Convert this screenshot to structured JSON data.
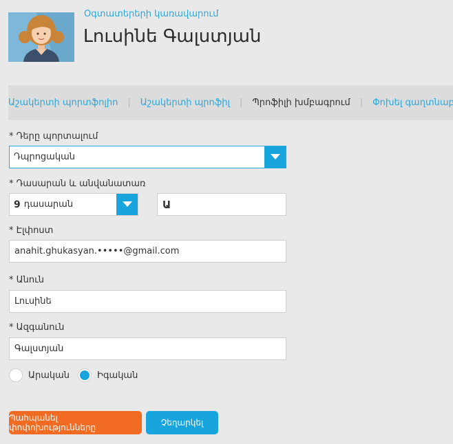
{
  "header": {
    "users_link": "Օգտատերերի կառավարում",
    "user_name": "Լուսինե Գալստյան"
  },
  "nav": {
    "items": [
      {
        "label": "Աշակերտի պորտֆոլիո",
        "active": false
      },
      {
        "label": "Աշակերտի պրոֆիլ",
        "active": false
      },
      {
        "label": "Պրոֆիլի խմբագրում",
        "active": true
      },
      {
        "label": "Փոխել գաղտնաբառը",
        "active": false
      }
    ],
    "separator": "|"
  },
  "form": {
    "role": {
      "label": "* Դերը պորտալում",
      "value": "Դպրոցական"
    },
    "class": {
      "label": "* Դասարան և անվանատառ",
      "grade_number": "9",
      "grade_value": "դասարան",
      "letter": "Ա"
    },
    "email": {
      "label": "* Էլփոստ",
      "value": "anahit.ghukasyan.•••••@gmail.com"
    },
    "first_name": {
      "label": "* Անուն",
      "value": "Լուսինե"
    },
    "last_name": {
      "label": "* Ազգանուն",
      "value": "Գալստյան"
    },
    "gender": {
      "male": "Արական",
      "female": "Իգական",
      "selected": "female"
    }
  },
  "buttons": {
    "save": "Պահպանել փոփոխությունները",
    "cancel": "Չեղարկել"
  },
  "colors": {
    "accent": "#18a5de",
    "save_button": "#f26b22",
    "background": "#e9e9e9"
  }
}
